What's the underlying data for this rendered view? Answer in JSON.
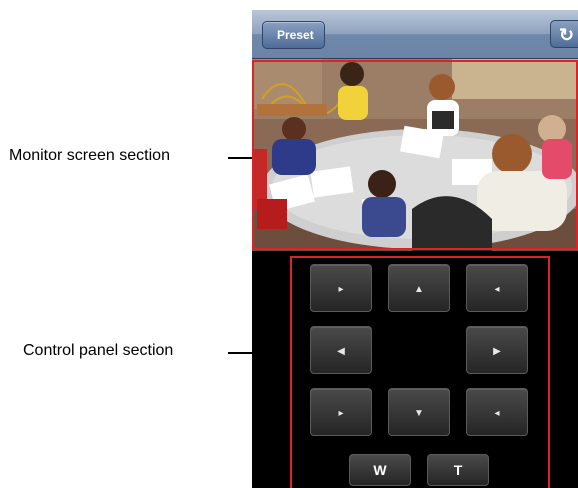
{
  "navbar": {
    "back_label": "Preset",
    "refresh_icon": "↻"
  },
  "annotations": {
    "monitor_label": "Monitor screen section",
    "control_label": "Control panel section"
  },
  "controls": {
    "up_left": "▸",
    "up": "▲",
    "up_right": "◂",
    "left": "◀",
    "right": "▶",
    "down_left": "▸",
    "down": "▼",
    "down_right": "◂",
    "zoom_wide": "W",
    "zoom_tele": "T"
  },
  "colors": {
    "frame": "#d9242a",
    "navbar": "#7088aa",
    "panel": "#000000"
  }
}
